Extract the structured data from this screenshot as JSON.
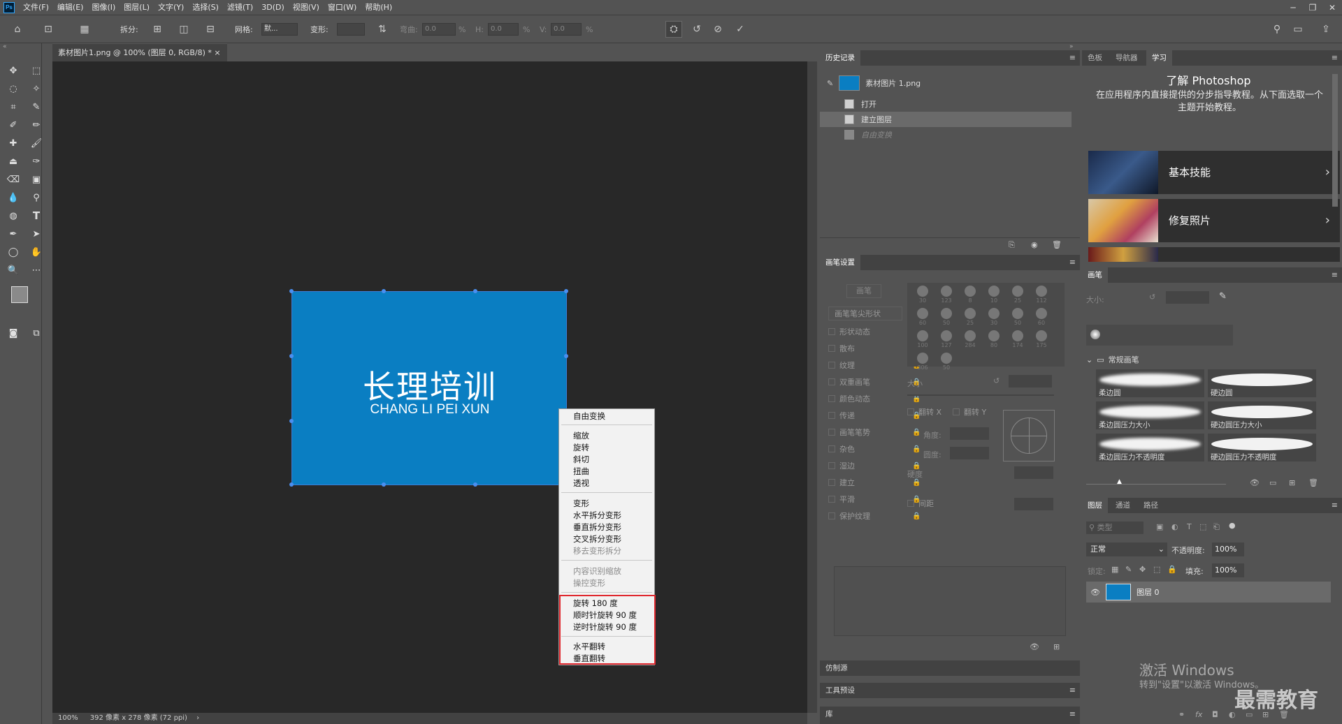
{
  "menubar": {
    "items": [
      "文件(F)",
      "编辑(E)",
      "图像(I)",
      "图层(L)",
      "文字(Y)",
      "选择(S)",
      "滤镜(T)",
      "3D(D)",
      "视图(V)",
      "窗口(W)",
      "帮助(H)"
    ]
  },
  "options": {
    "split_label": "拆分:",
    "grid_label": "网格:",
    "grid_value": "默...",
    "warp_label": "变形:",
    "bend_label": "弯曲:",
    "bend_value": "0.0",
    "pct": "%",
    "h_label": "H:",
    "h_value": "0.0",
    "v_label": "V:",
    "v_value": "0.0"
  },
  "document": {
    "tab_title": "素材图片1.png @ 100% (图层 0, RGB/8) *",
    "image_title": "长理培训",
    "image_subtitle": "CHANG LI PEI XUN",
    "zoom": "100%",
    "size_info": "392 像素 x 278 像素 (72 ppi)",
    "image_color": "#0a7ec2"
  },
  "context_menu": {
    "group1": [
      "自由变换"
    ],
    "group2": [
      "缩放",
      "旋转",
      "斜切",
      "扭曲",
      "透视"
    ],
    "group3": [
      "变形",
      "水平拆分变形",
      "垂直拆分变形",
      "交叉拆分变形"
    ],
    "group3_disabled": "移去变形拆分",
    "group4_disabled": [
      "内容识别缩放",
      "操控变形"
    ],
    "group5": [
      "旋转 180 度",
      "顺时针旋转 90 度",
      "逆时针旋转 90 度"
    ],
    "group6": [
      "水平翻转",
      "垂直翻转"
    ],
    "highlight_color": "#e0282e"
  },
  "history": {
    "title": "历史记录",
    "snapshot": "素材图片 1.png",
    "steps": [
      "打开",
      "建立图层",
      "自由变换"
    ]
  },
  "brush_settings": {
    "title": "画笔设置",
    "brush_btn": "画笔",
    "tip_shape": "画笔笔尖形状",
    "options": [
      "形状动态",
      "散布",
      "纹理",
      "双重画笔",
      "颜色动态",
      "传递",
      "画笔笔势",
      "杂色",
      "湿边",
      "建立",
      "平滑",
      "保护纹理"
    ],
    "size_label": "大小",
    "flip_x": "翻转 X",
    "flip_y": "翻转 Y",
    "angle_label": "角度:",
    "roundness_label": "圆度:",
    "hardness_label": "硬度",
    "spacing_label": "间距",
    "preset_sizes": [
      "30",
      "123",
      "8",
      "10",
      "25",
      "112",
      "60",
      "50",
      "25",
      "30",
      "50",
      "60",
      "100",
      "127",
      "284",
      "80",
      "174",
      "175",
      "306",
      "50"
    ]
  },
  "side_panels": {
    "clone_source": "仿制源",
    "tool_presets": "工具预设",
    "library": "库"
  },
  "learn": {
    "tabs": [
      "色板",
      "导航器",
      "学习"
    ],
    "heading": "了解 Photoshop",
    "desc": "在应用程序内直接提供的分步指导教程。从下面选取一个主题开始教程。",
    "cards": [
      "基本技能",
      "修复照片"
    ]
  },
  "brushes": {
    "title": "画笔",
    "size_label": "大小:",
    "group": "常规画笔",
    "items": [
      "柔边圆",
      "硬边圆",
      "柔边圆压力大小",
      "硬边圆压力大小",
      "柔边圆压力不透明度",
      "硬边圆压力不透明度"
    ]
  },
  "layers": {
    "tabs": [
      "图层",
      "通道",
      "路径"
    ],
    "search_placeholder": "类型",
    "blend": "正常",
    "opacity_label": "不透明度:",
    "opacity": "100%",
    "lock_label": "锁定:",
    "fill_label": "填充:",
    "fill": "100%",
    "layer_name": "图层 0"
  },
  "watermark": {
    "line1": "激活 Windows",
    "line2": "转到\"设置\"以激活 Windows。",
    "brand": "最需教育"
  }
}
